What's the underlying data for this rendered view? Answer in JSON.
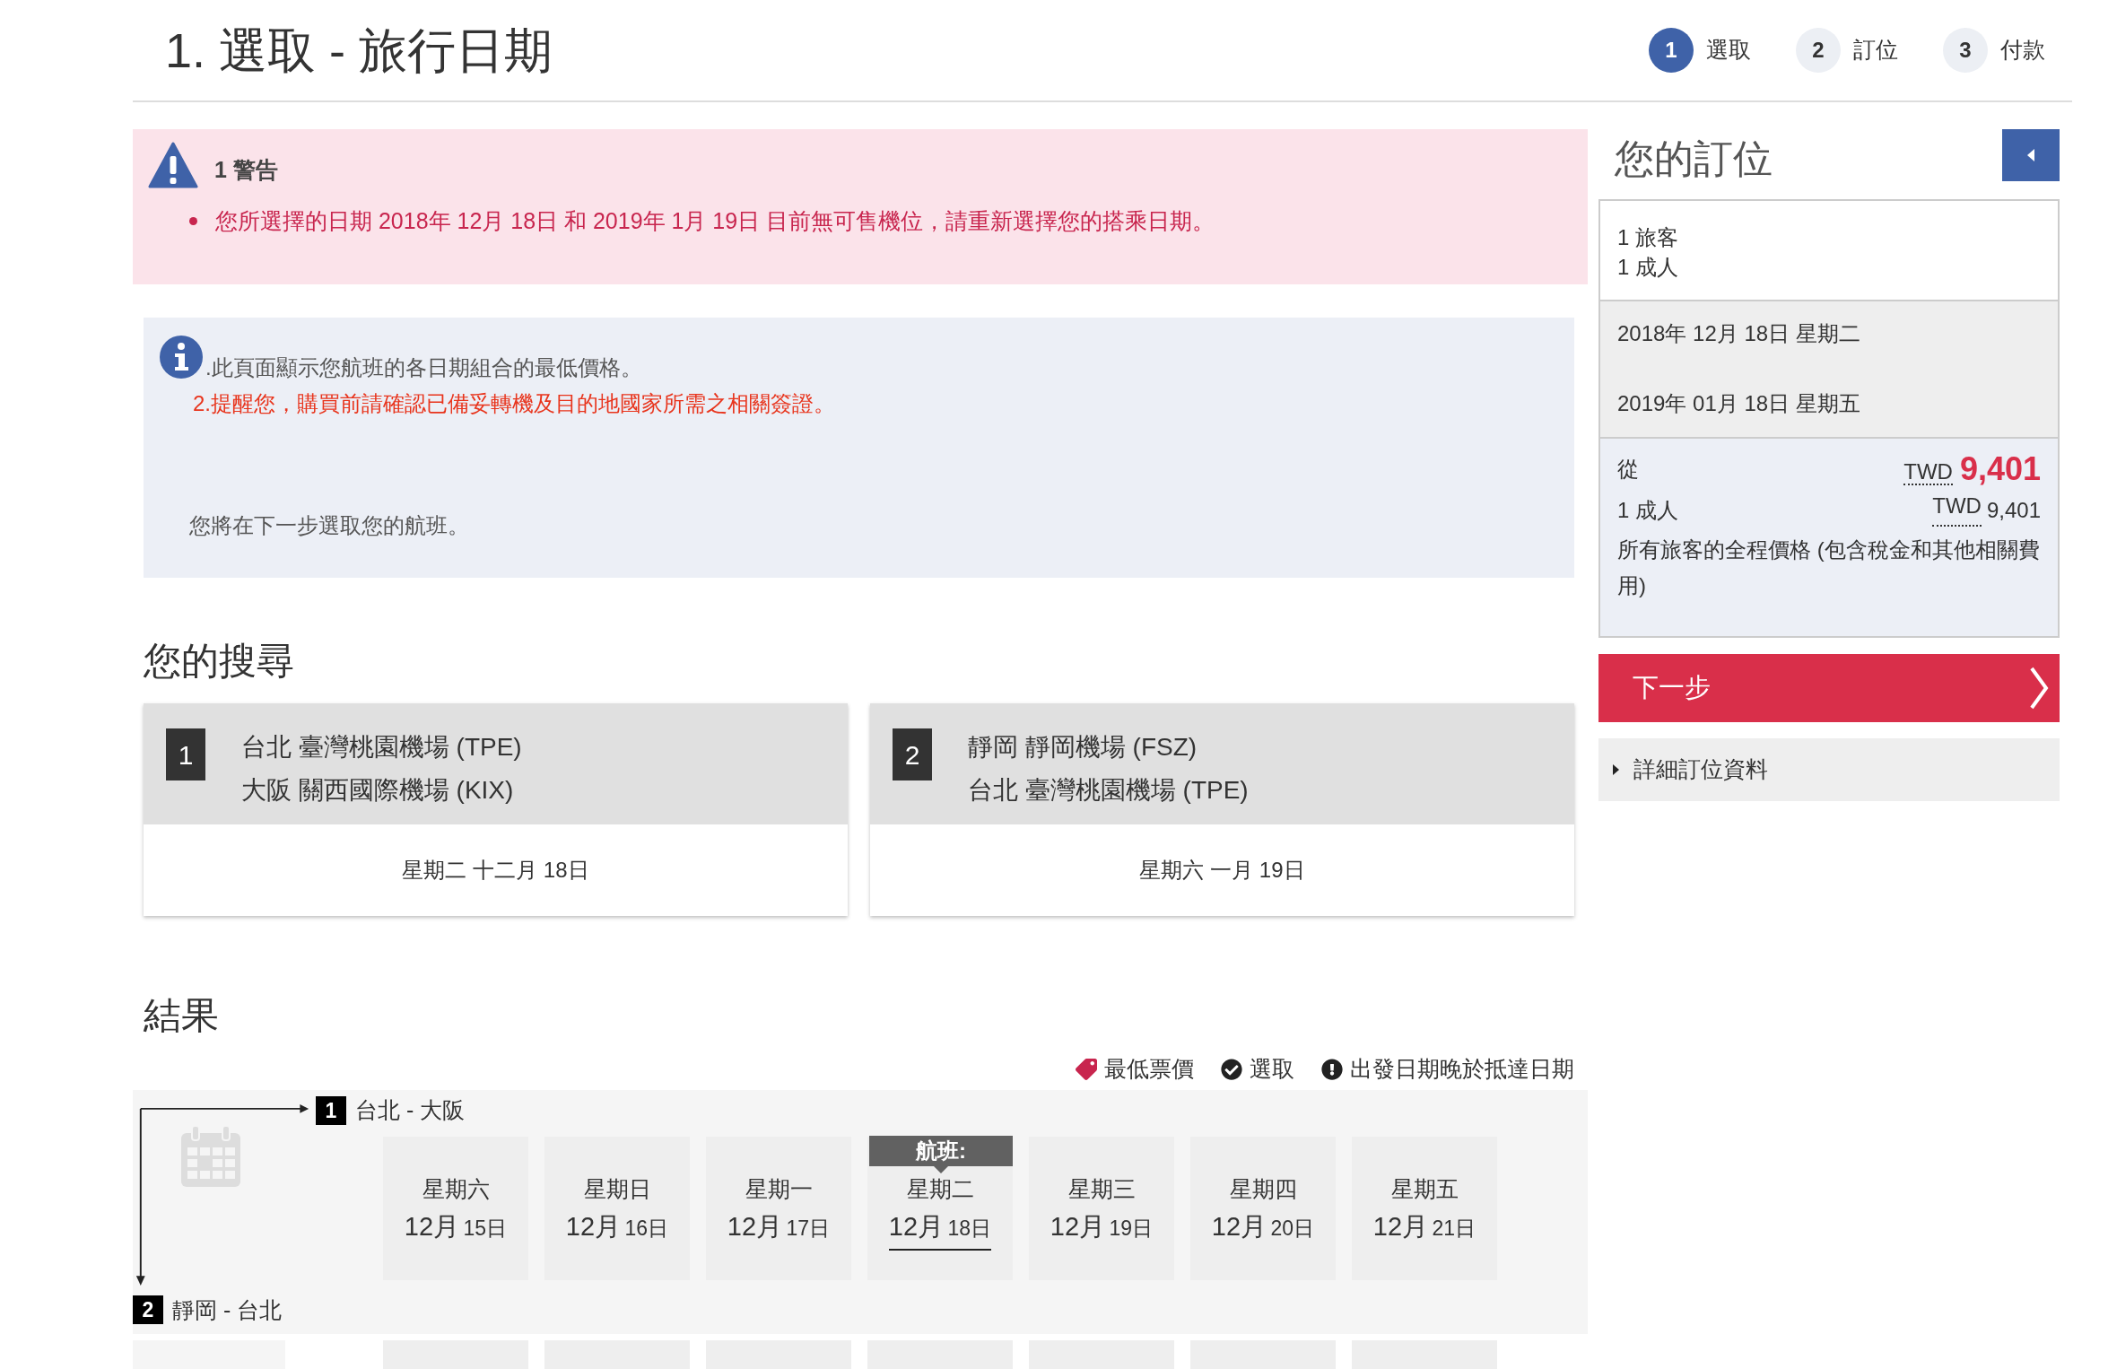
{
  "header": {
    "title": "1. 選取 - 旅行日期"
  },
  "steps": [
    {
      "number": "1",
      "label": "選取",
      "selected": true
    },
    {
      "number": "2",
      "label": "訂位",
      "selected": false
    },
    {
      "number": "3",
      "label": "付款",
      "selected": false
    }
  ],
  "warning": {
    "title": "1 警告",
    "messages": [
      "您所選擇的日期 2018年 12月 18日 和 2019年 1月 19日 目前無可售機位，請重新選擇您的搭乘日期。"
    ]
  },
  "info": {
    "lines": [
      {
        "kind": "note",
        "text": ".此頁面顯示您航班的各日期組合的最低價格。"
      },
      {
        "kind": "reminder",
        "text": "2.提醒您，購買前請確認已備妥轉機及目的地國家所需之相關簽證。"
      }
    ],
    "footer": "您將在下一步選取您的航班。"
  },
  "search": {
    "title": "您的搜尋",
    "legs": [
      {
        "number": "1",
        "from": "台北 臺灣桃園機場 (TPE)",
        "to": "大阪 關西國際機場 (KIX)",
        "date": "星期二 十二月 18日"
      },
      {
        "number": "2",
        "from": "靜岡 靜岡機場 (FSZ)",
        "to": "台北 臺灣桃園機場 (TPE)",
        "date": "星期六 一月 19日"
      }
    ]
  },
  "results": {
    "title": "結果",
    "legend": [
      {
        "kind": "lowest_fare",
        "label": "最低票價"
      },
      {
        "kind": "selected",
        "label": "選取"
      },
      {
        "kind": "late_departure",
        "label": "出發日期晚於抵達日期"
      }
    ],
    "outbound": {
      "number": "1",
      "label": "台北 - 大阪"
    },
    "inbound": {
      "number": "2",
      "label": "靜岡 - 台北"
    },
    "flight_label": "航班:",
    "days": [
      {
        "weekday": "星期六",
        "month": "12月",
        "day": "15日",
        "selected": false
      },
      {
        "weekday": "星期日",
        "month": "12月",
        "day": "16日",
        "selected": false
      },
      {
        "weekday": "星期一",
        "month": "12月",
        "day": "17日",
        "selected": false
      },
      {
        "weekday": "星期二",
        "month": "12月",
        "day": "18日",
        "selected": true
      },
      {
        "weekday": "星期三",
        "month": "12月",
        "day": "19日",
        "selected": false
      },
      {
        "weekday": "星期四",
        "month": "12月",
        "day": "20日",
        "selected": false
      },
      {
        "weekday": "星期五",
        "month": "12月",
        "day": "21日",
        "selected": false
      }
    ]
  },
  "booking": {
    "title": "您的訂位",
    "passengers": [
      "1 旅客",
      "1 成人"
    ],
    "dates": [
      "2018年 12月 18日 星期二",
      "2019年 01月 18日 星期五"
    ],
    "from_label": "從",
    "currency": "TWD",
    "total": "9,401",
    "adult_label": "1 成人",
    "adult_currency": "TWD",
    "adult_price": "9,401",
    "note": "所有旅客的全程價格 (包含稅金和其他相關費用)",
    "next_button": "下一步",
    "details": "詳細訂位資料"
  }
}
